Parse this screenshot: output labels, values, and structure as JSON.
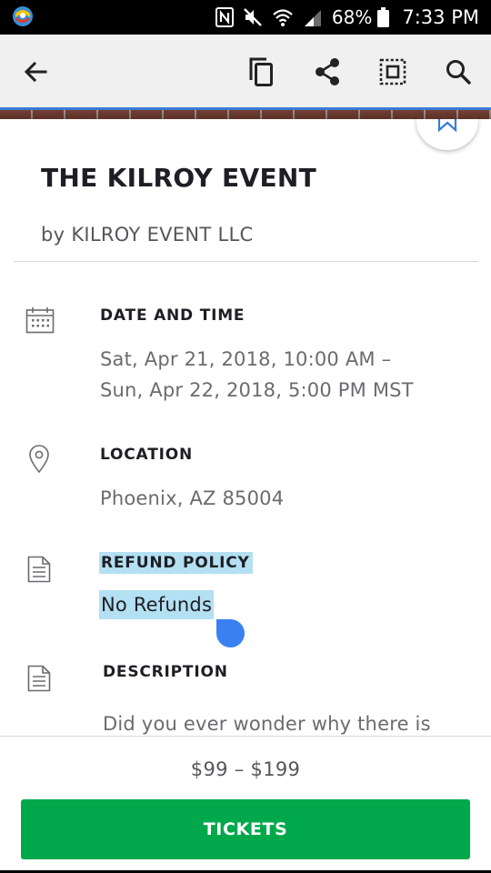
{
  "status_bar": {
    "battery_percent": "68%",
    "time": "7:33 PM",
    "icons": [
      "app-icon",
      "nfc-icon",
      "mute-icon",
      "wifi-icon",
      "signal-icon",
      "battery-icon"
    ]
  },
  "toolbar": {
    "icons": [
      "back-arrow-icon",
      "copy-icon",
      "share-icon",
      "select-all-icon",
      "search-icon"
    ]
  },
  "event": {
    "title": "THE KILROY EVENT",
    "organizer": "by KILROY EVENT LLC",
    "bookmark_icon": "bookmark-icon"
  },
  "sections": {
    "date_time": {
      "heading": "DATE AND TIME",
      "line1": "Sat, Apr 21, 2018, 10:00 AM –",
      "line2": "Sun, Apr 22, 2018, 5:00 PM MST",
      "icon": "calendar-icon"
    },
    "location": {
      "heading": "LOCATION",
      "body": "Phoenix, AZ 85004",
      "icon": "location-pin-icon"
    },
    "refund_policy": {
      "heading": "REFUND POLICY",
      "body": "No Refunds",
      "icon": "document-icon",
      "highlight_color": "#b3e0f2"
    },
    "description": {
      "heading": "DESCRIPTION",
      "body": "Did you ever wonder why there is",
      "icon": "document-icon"
    }
  },
  "footer": {
    "price_range": "$99 – $199",
    "tickets_label": "TICKETS",
    "button_color": "#00a84c"
  }
}
